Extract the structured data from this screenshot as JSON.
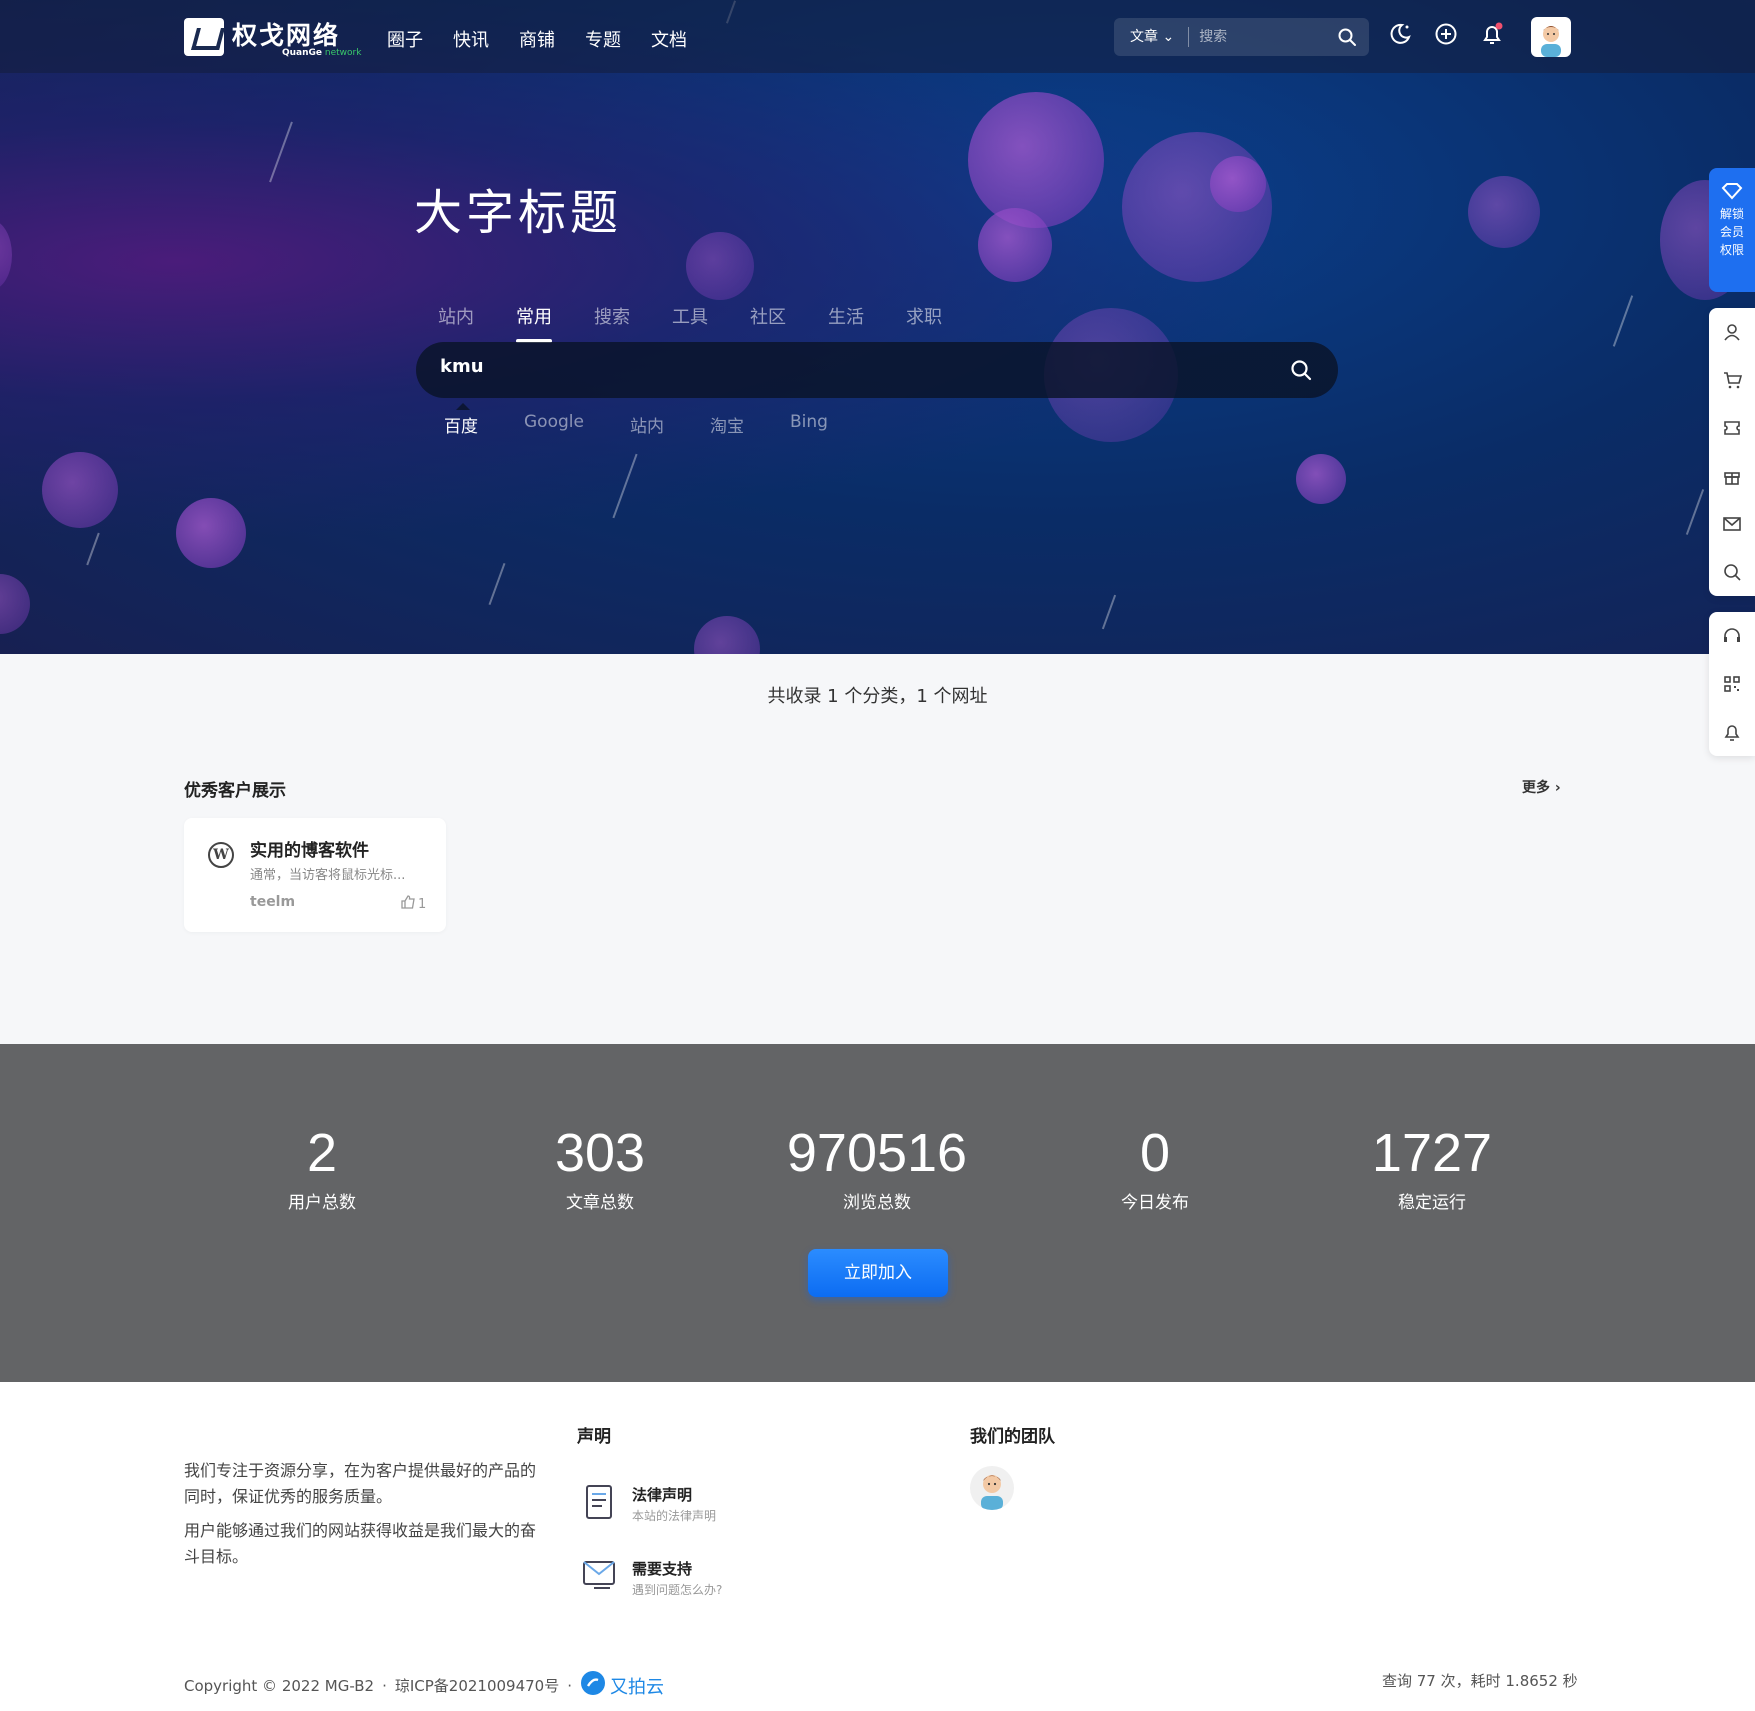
{
  "header": {
    "logo_cn": "权戈网络",
    "logo_en_a": "QuanGe",
    "logo_en_b": "network",
    "nav": [
      "圈子",
      "快讯",
      "商铺",
      "专题",
      "文档"
    ],
    "search_type": "文章",
    "search_placeholder": "搜索"
  },
  "hero": {
    "title": "大字标题",
    "tabs": [
      "站内",
      "常用",
      "搜索",
      "工具",
      "社区",
      "生活",
      "求职"
    ],
    "active_tab": "常用",
    "search_value": "kmu",
    "engines": [
      "百度",
      "Google",
      "站内",
      "淘宝",
      "Bing"
    ],
    "active_engine": "百度"
  },
  "sidebar": {
    "vip_label": [
      "解锁",
      "会员",
      "权限"
    ],
    "icons": [
      "user-icon",
      "cart-icon",
      "ticket-icon",
      "gift-icon",
      "mail-icon",
      "search-icon",
      "headset-icon",
      "qrcode-icon",
      "bell-icon"
    ]
  },
  "summary": "共收录 1 个分类，1 个网址",
  "section": {
    "title": "优秀客户展示",
    "more": "更多",
    "card": {
      "title": "实用的博客软件",
      "desc": "通常，当访客将鼠标光标...",
      "author": "teelm",
      "likes": "1"
    }
  },
  "stats": [
    {
      "num": "2",
      "label": "用户总数"
    },
    {
      "num": "303",
      "label": "文章总数"
    },
    {
      "num": "970516",
      "label": "浏览总数"
    },
    {
      "num": "0",
      "label": "今日发布"
    },
    {
      "num": "1727",
      "label": "稳定运行"
    }
  ],
  "join_label": "立即加入",
  "footer": {
    "about_1": "我们专注于资源分享，在为客户提供最好的产品的同时，保证优秀的服务质量。",
    "about_2": "用户能够通过我们的网站获得收益是我们最大的奋斗目标。",
    "statement_title": "声明",
    "legal_title": "法律声明",
    "legal_sub": "本站的法律声明",
    "support_title": "需要支持",
    "support_sub": "遇到问题怎么办?",
    "team_title": "我们的团队",
    "copyright": "Copyright © 2022 MG-B2",
    "icp": "琼ICP备2021009470号",
    "brand": "又拍云",
    "query": "查询 77 次，耗时 1.8652 秒"
  },
  "colors": {
    "accent": "#1e6ff0",
    "stats_bg": "#636466"
  }
}
